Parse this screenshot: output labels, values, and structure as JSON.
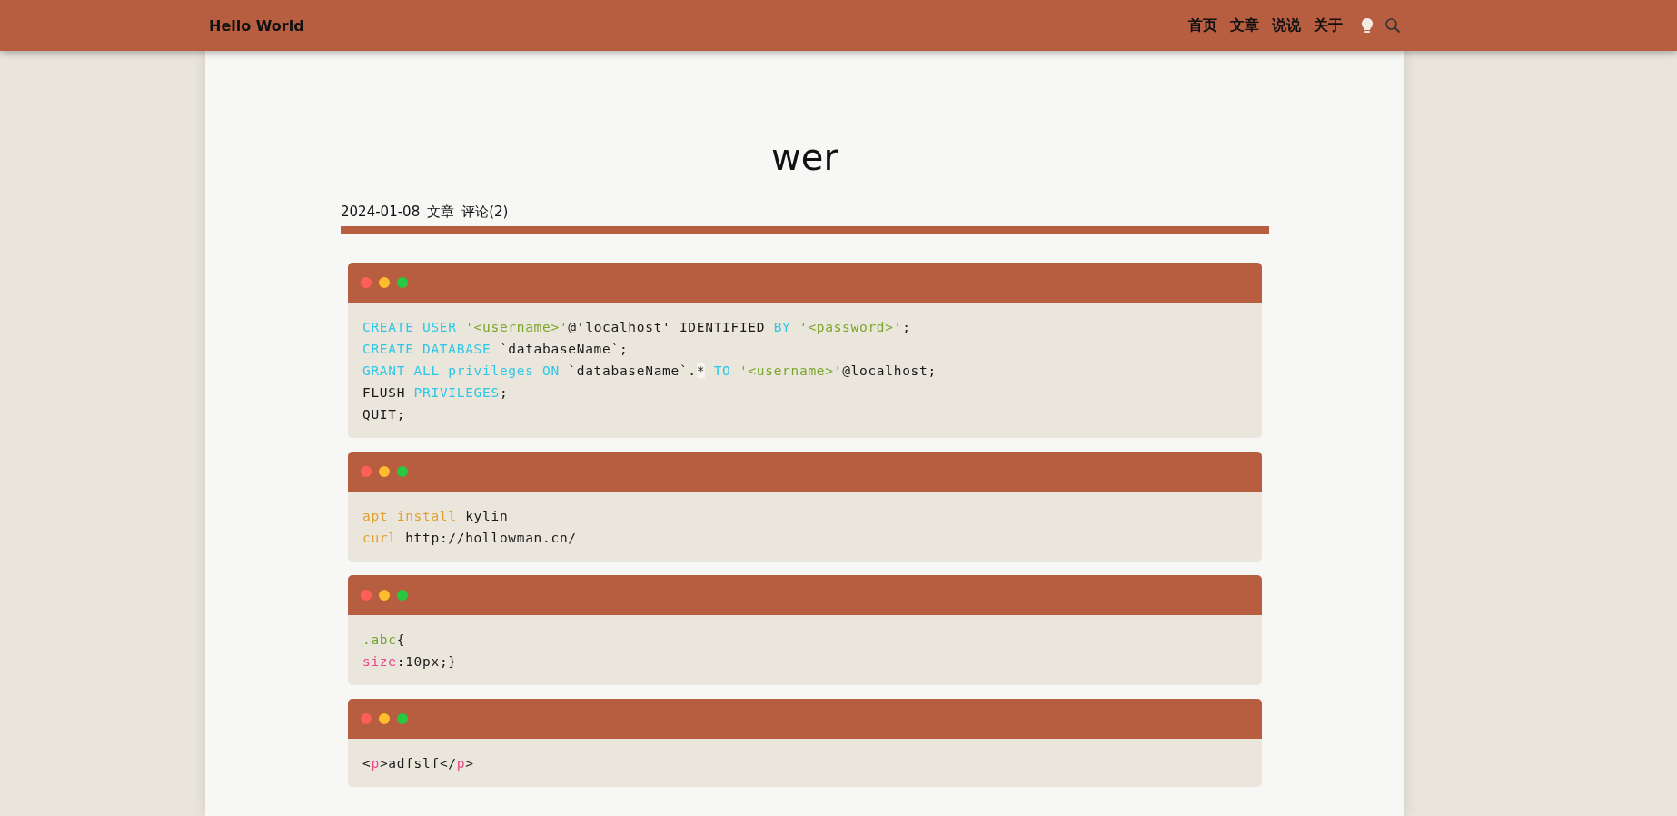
{
  "header": {
    "brand": "Hello World",
    "nav": [
      {
        "label": "首页"
      },
      {
        "label": "文章"
      },
      {
        "label": "说说"
      },
      {
        "label": "关于"
      }
    ]
  },
  "post": {
    "title": "wer",
    "date": "2024-01-08",
    "category": "文章",
    "comments": "评论(2)"
  },
  "code_blocks": [
    {
      "lines": [
        [
          {
            "kind": "keyword",
            "text": "CREATE USER "
          },
          {
            "kind": "string",
            "text": "'<username>'"
          },
          {
            "kind": "plain",
            "text": "@'localhost' IDENTIFIED "
          },
          {
            "kind": "keyword",
            "text": "BY "
          },
          {
            "kind": "string",
            "text": "'<password>'"
          },
          {
            "kind": "plain",
            "text": ";"
          }
        ],
        [
          {
            "kind": "keyword",
            "text": "CREATE DATABASE "
          },
          {
            "kind": "plain",
            "text": "`databaseName`;"
          }
        ],
        [
          {
            "kind": "keyword",
            "text": "GRANT ALL privileges ON "
          },
          {
            "kind": "plain",
            "text": "`databaseName`."
          },
          {
            "kind": "mark",
            "text": "*"
          },
          {
            "kind": "keyword",
            "text": " TO "
          },
          {
            "kind": "string",
            "text": "'<username>'"
          },
          {
            "kind": "plain",
            "text": "@localhost;"
          }
        ],
        [
          {
            "kind": "plain",
            "text": "FLUSH "
          },
          {
            "kind": "keyword",
            "text": "PRIVILEGES"
          },
          {
            "kind": "plain",
            "text": ";"
          }
        ],
        [
          {
            "kind": "plain",
            "text": "QUIT;"
          }
        ]
      ]
    },
    {
      "lines": [
        [
          {
            "kind": "command",
            "text": "apt install "
          },
          {
            "kind": "plain",
            "text": "kylin"
          }
        ],
        [
          {
            "kind": "command",
            "text": "curl "
          },
          {
            "kind": "plain",
            "text": "http://hollowman.cn/"
          }
        ]
      ]
    },
    {
      "lines": [
        [
          {
            "kind": "selector",
            "text": ".abc"
          },
          {
            "kind": "plain",
            "text": "{"
          }
        ],
        [
          {
            "kind": "property",
            "text": "size"
          },
          {
            "kind": "plain",
            "text": ":10px;}"
          }
        ]
      ]
    },
    {
      "lines": [
        [
          {
            "kind": "plain",
            "text": "<"
          },
          {
            "kind": "tag",
            "text": "p"
          },
          {
            "kind": "plain",
            "text": ">adfslf</"
          },
          {
            "kind": "tag",
            "text": "p"
          },
          {
            "kind": "plain",
            "text": ">"
          }
        ]
      ]
    }
  ]
}
